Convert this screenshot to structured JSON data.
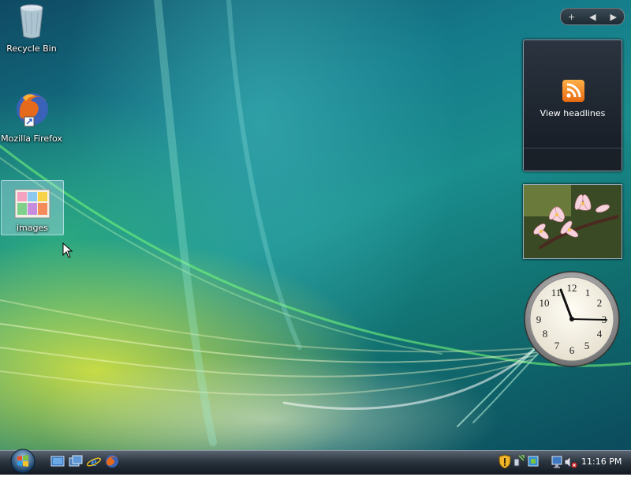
{
  "desktop_icons": [
    {
      "label": "Recycle Bin",
      "icon": "recycle-bin-icon"
    },
    {
      "label": "Mozilla Firefox",
      "icon": "firefox-icon"
    },
    {
      "label": "images",
      "icon": "folder-icon",
      "selected": true
    }
  ],
  "gadgets": {
    "toolbar": {
      "add": "+",
      "prev": "◀",
      "next": "▶"
    },
    "feed_headlines": {
      "text": "View headlines",
      "icon": "rss-icon"
    },
    "slideshow": {
      "icon": "flower-photo"
    },
    "clock": {
      "numbers": [
        "12",
        "1",
        "2",
        "3",
        "4",
        "5",
        "6",
        "7",
        "8",
        "9",
        "10",
        "11"
      ],
      "time": "11:16"
    }
  },
  "taskbar": {
    "start": {
      "icon": "windows-orb-icon"
    },
    "quick_launch": [
      {
        "icon": "show-desktop-icon"
      },
      {
        "icon": "switch-windows-icon"
      },
      {
        "icon": "internet-explorer-icon"
      },
      {
        "icon": "firefox-icon"
      }
    ],
    "tray": {
      "icons": [
        "security-shield-icon",
        "network-icon",
        "windows-update-icon",
        "network-connection-icon",
        "volume-muted-icon"
      ],
      "clock": "11:16 PM"
    }
  },
  "colors": {
    "accent_rss": "#f07a20",
    "taskbar": "#1e2630"
  }
}
